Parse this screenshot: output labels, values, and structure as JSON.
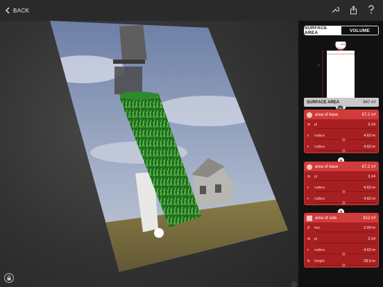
{
  "topbar": {
    "back_label": "BACK"
  },
  "tabs": {
    "surface_area": "SURFACE AREA",
    "volume": "VOLUME"
  },
  "diagram": {
    "circumference_label": "2πr",
    "height_label": "h"
  },
  "surface_area": {
    "label": "SURFACE AREA",
    "value": "947 m²"
  },
  "cards": [
    {
      "title": "area of base",
      "value": "67.2 m²",
      "rows": [
        {
          "sym": "π",
          "name": "pi",
          "value": "3.14"
        },
        {
          "sym": "r",
          "name": "radius",
          "value": "4.62 m"
        },
        {
          "sym": "r",
          "name": "radius",
          "value": "4.62 m"
        }
      ]
    },
    {
      "title": "area of base",
      "value": "67.2 m²",
      "rows": [
        {
          "sym": "π",
          "name": "pi",
          "value": "3.14"
        },
        {
          "sym": "r",
          "name": "radius",
          "value": "4.62 m"
        },
        {
          "sym": "r",
          "name": "radius",
          "value": "4.62 m"
        }
      ]
    },
    {
      "title": "area of side",
      "value": "812 m²",
      "rows": [
        {
          "sym": "2",
          "name": "two",
          "value": "2.00 m"
        },
        {
          "sym": "π",
          "name": "pi",
          "value": "3.14"
        },
        {
          "sym": "r",
          "name": "radius",
          "value": "4.62 m"
        },
        {
          "sym": "h",
          "name": "height",
          "value": "28.0 m"
        }
      ]
    }
  ],
  "colors": {
    "accent_red": "#a81f21",
    "header_red": "#d23b3b",
    "cylinder_green": "#2f8a2f"
  },
  "icons": [
    "chevron-left-icon",
    "wrench-icon",
    "share-icon",
    "help-icon",
    "lock-icon"
  ]
}
